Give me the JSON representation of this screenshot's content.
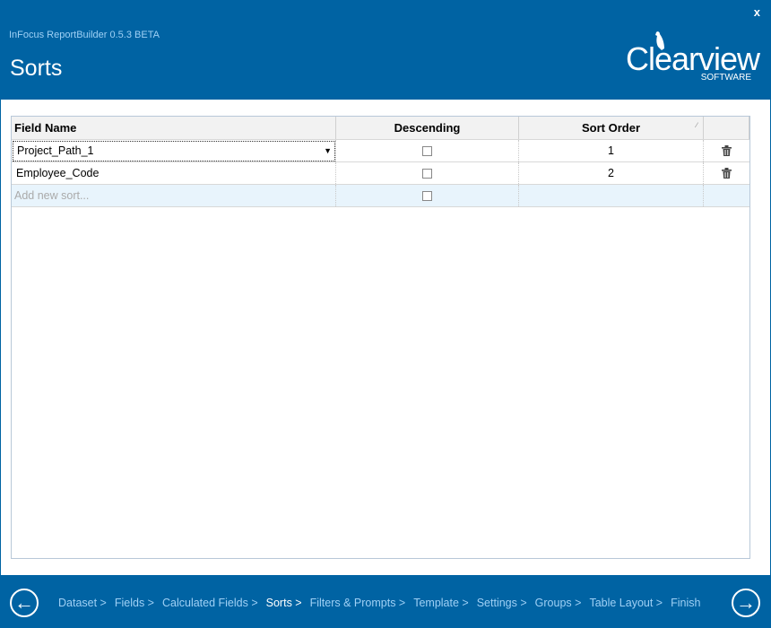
{
  "window": {
    "app_name": "InFocus ReportBuilder 0.5.3 BETA",
    "page_title": "Sorts",
    "close_label": "x"
  },
  "logo": {
    "wordmark": "Clearview",
    "tagline": "SOFTWARE"
  },
  "grid": {
    "columns": [
      "Field Name",
      "Descending",
      "Sort Order",
      ""
    ],
    "rows": [
      {
        "field": "Project_Path_1",
        "descending": false,
        "order": "1"
      },
      {
        "field": "Employee_Code",
        "descending": false,
        "order": "2"
      }
    ],
    "new_row_placeholder": "Add new sort..."
  },
  "nav": {
    "steps": [
      "Dataset >",
      "Fields >",
      "Calculated Fields >",
      "Sorts >",
      "Filters & Prompts >",
      "Template >",
      "Settings >",
      "Groups >",
      "Table Layout >",
      "Finish"
    ],
    "current": "Sorts >"
  },
  "colors": {
    "brand": "#0063a3"
  }
}
